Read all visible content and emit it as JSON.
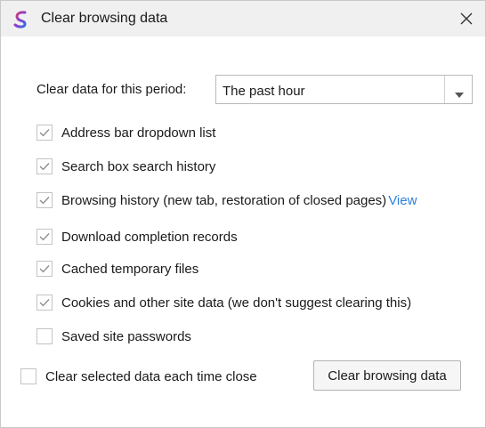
{
  "window": {
    "title": "Clear browsing data",
    "app_icon": "browser-logo-icon",
    "close_icon": "close-icon"
  },
  "period": {
    "label": "Clear data for this period:",
    "selected": "The past hour"
  },
  "options": [
    {
      "label": "Address bar dropdown list",
      "checked": true
    },
    {
      "label": "Search box search history",
      "checked": true
    },
    {
      "label": "Browsing history (new tab, restoration of closed pages)",
      "checked": true,
      "link": "View"
    },
    {
      "label": "Download completion records",
      "checked": true
    },
    {
      "label": "Cached temporary files",
      "checked": true
    },
    {
      "label": "Cookies and other site data (we don't suggest clearing this)",
      "checked": true
    },
    {
      "label": "Saved site passwords",
      "checked": false
    }
  ],
  "footer": {
    "auto_clear_label": "Clear selected data each time close",
    "auto_clear_checked": false,
    "clear_button": "Clear browsing data"
  },
  "colors": {
    "titlebar": "#f0f0f0",
    "link": "#2d7fe0",
    "check": "#8a8a8a"
  }
}
